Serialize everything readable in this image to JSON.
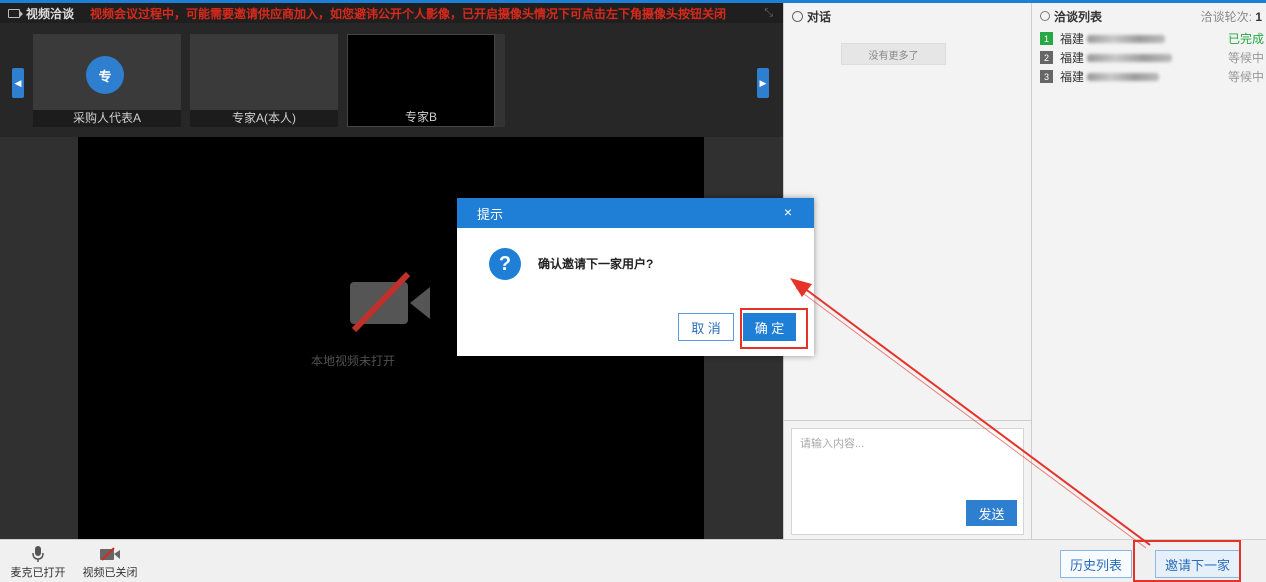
{
  "video": {
    "title": "视频洽谈",
    "notice": "视频会议过程中，可能需要邀请供应商加入，如您避讳公开个人影像，已开启摄像头情况下可点击左下角摄像头按钮关闭",
    "thumbnails": [
      {
        "label": "采购人代表A",
        "avatar": "专"
      },
      {
        "label": "专家A(本人)"
      },
      {
        "label": "专家B"
      }
    ],
    "main_placeholder": "本地视频未打开"
  },
  "toolbar": {
    "mic_label": "麦克已打开",
    "camera_label": "视频已关闭",
    "history_label": "历史列表",
    "invite_label": "邀请下一家"
  },
  "chat": {
    "title": "对话",
    "more_label": "没有更多了",
    "input_placeholder": "请输入内容...",
    "send_label": "发送"
  },
  "negotiation": {
    "title": "洽谈列表",
    "round_label": "洽谈轮次:",
    "round_value": "1",
    "items": [
      {
        "num": "1",
        "name": "福建",
        "status": "已完成"
      },
      {
        "num": "2",
        "name": "福建",
        "status": "等候中"
      },
      {
        "num": "3",
        "name": "福建",
        "status": "等候中"
      }
    ]
  },
  "dialog": {
    "title": "提示",
    "close": "×",
    "message": "确认邀请下一家用户?",
    "cancel_label": "取 消",
    "ok_label": "确 定"
  },
  "colors": {
    "accent": "#1f7fd6",
    "danger": "#e5332a",
    "success": "#27a844"
  }
}
